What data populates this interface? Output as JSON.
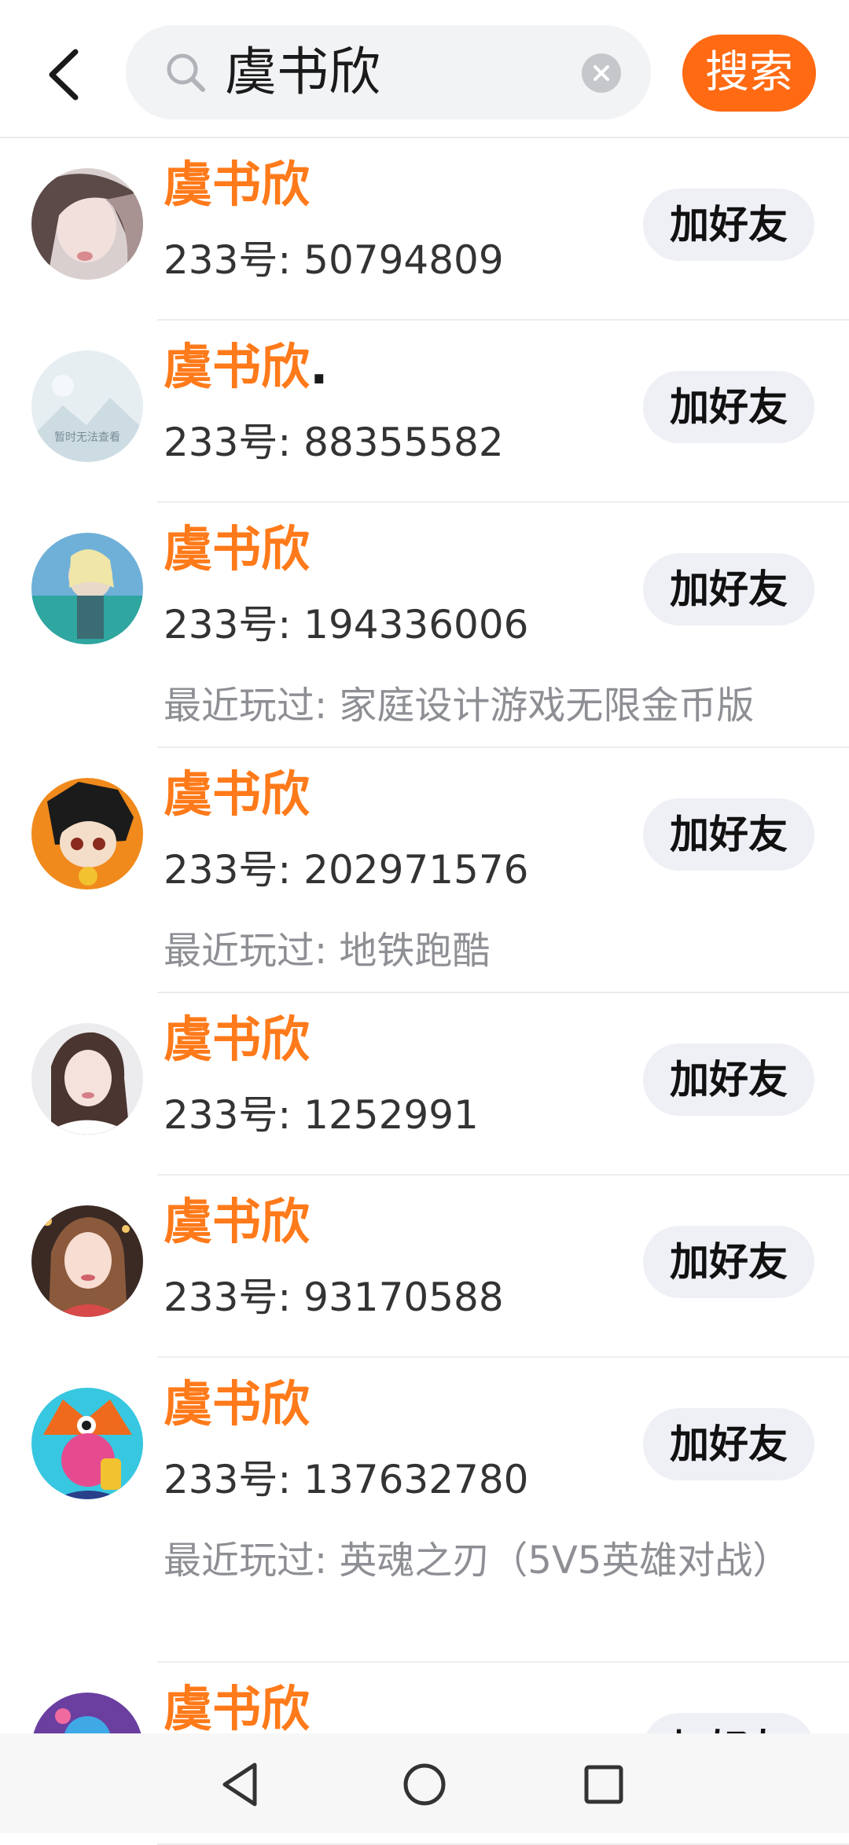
{
  "header": {
    "search_value": "虞书欣",
    "search_label": "搜索"
  },
  "add_label": "加好友",
  "results": [
    {
      "name": "虞书欣",
      "suffix": "",
      "uid": "233号: 50794809",
      "played": ""
    },
    {
      "name": "虞书欣",
      "suffix": ".",
      "uid": "233号: 88355582",
      "played": "",
      "avatar_text": "暂时无法查看"
    },
    {
      "name": "虞书欣",
      "suffix": "",
      "uid": "233号: 194336006",
      "played": "最近玩过: 家庭设计游戏无限金币版"
    },
    {
      "name": "虞书欣",
      "suffix": "",
      "uid": "233号: 202971576",
      "played": "最近玩过: 地铁跑酷"
    },
    {
      "name": "虞书欣",
      "suffix": "",
      "uid": "233号: 1252991",
      "played": ""
    },
    {
      "name": "虞书欣",
      "suffix": "",
      "uid": "233号: 93170588",
      "played": ""
    },
    {
      "name": "虞书欣",
      "suffix": "",
      "uid": "233号: 137632780",
      "played": "最近玩过: 英魂之刃（5V5英雄对战）"
    },
    {
      "name": "虞书欣",
      "suffix": "",
      "uid": "",
      "played": ""
    }
  ],
  "colors": {
    "accent": "#ff6a13",
    "name": "#ff7a1a"
  },
  "icons": {
    "back": "chevron-left-icon",
    "search": "search-icon",
    "clear": "clear-icon"
  }
}
